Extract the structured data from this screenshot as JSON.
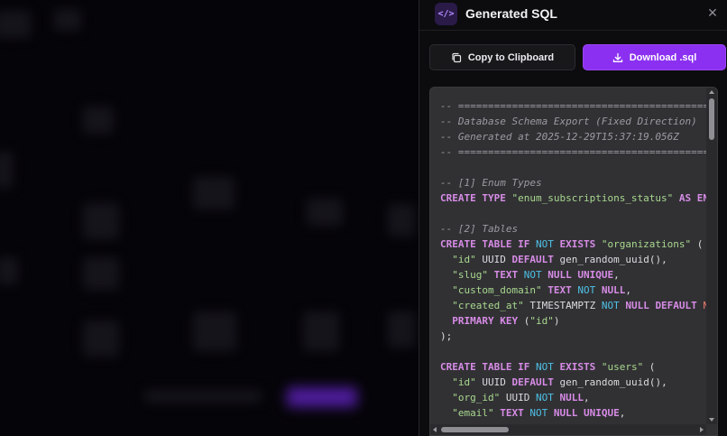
{
  "panel": {
    "title": "Generated SQL",
    "code_badge": "</>",
    "close_glyph": "✕"
  },
  "actions": {
    "copy_label": "Copy to Clipboard",
    "download_label": "Download .sql"
  },
  "colors": {
    "accent": "#8b30f0",
    "keyword": "#d78ce6",
    "string": "#a9d88e",
    "not_keyword": "#4fc1e6",
    "function": "#f07c70",
    "comment": "#9a9aa2"
  },
  "code_lines": [
    [
      {
        "t": "-- ===========================================",
        "c": "c"
      }
    ],
    [
      {
        "t": "-- Database Schema Export (Fixed Direction)",
        "c": "c"
      }
    ],
    [
      {
        "t": "-- Generated at 2025-12-29T15:37:19.056Z",
        "c": "c"
      }
    ],
    [
      {
        "t": "-- ===========================================",
        "c": "c"
      }
    ],
    [],
    [
      {
        "t": "-- [1] Enum Types",
        "c": "c"
      }
    ],
    [
      {
        "t": "CREATE TYPE ",
        "c": "k"
      },
      {
        "t": "\"enum_subscriptions_status\"",
        "c": "s"
      },
      {
        "t": " ",
        "c": ""
      },
      {
        "t": "AS ENUM",
        "c": "k"
      }
    ],
    [],
    [
      {
        "t": "-- [2] Tables",
        "c": "c"
      }
    ],
    [
      {
        "t": "CREATE TABLE IF ",
        "c": "k"
      },
      {
        "t": "NOT",
        "c": "n"
      },
      {
        "t": " EXISTS ",
        "c": "k"
      },
      {
        "t": "\"organizations\"",
        "c": "s"
      },
      {
        "t": " (",
        "c": ""
      }
    ],
    [
      {
        "t": "  ",
        "c": ""
      },
      {
        "t": "\"id\"",
        "c": "s"
      },
      {
        "t": " UUID ",
        "c": ""
      },
      {
        "t": "DEFAULT",
        "c": "k"
      },
      {
        "t": " gen_random_uuid(),",
        "c": ""
      }
    ],
    [
      {
        "t": "  ",
        "c": ""
      },
      {
        "t": "\"slug\"",
        "c": "s"
      },
      {
        "t": " TEXT ",
        "c": "k"
      },
      {
        "t": "NOT",
        "c": "n"
      },
      {
        "t": " NULL UNIQUE",
        "c": "k"
      },
      {
        "t": ",",
        "c": ""
      }
    ],
    [
      {
        "t": "  ",
        "c": ""
      },
      {
        "t": "\"custom_domain\"",
        "c": "s"
      },
      {
        "t": " TEXT ",
        "c": "k"
      },
      {
        "t": "NOT",
        "c": "n"
      },
      {
        "t": " NULL",
        "c": "k"
      },
      {
        "t": ",",
        "c": ""
      }
    ],
    [
      {
        "t": "  ",
        "c": ""
      },
      {
        "t": "\"created_at\"",
        "c": "s"
      },
      {
        "t": " TIMESTAMPTZ ",
        "c": ""
      },
      {
        "t": "NOT",
        "c": "n"
      },
      {
        "t": " NULL DEFAULT ",
        "c": "k"
      },
      {
        "t": "NOW",
        "c": "f"
      },
      {
        "t": "(",
        "c": ""
      }
    ],
    [
      {
        "t": "  ",
        "c": ""
      },
      {
        "t": "PRIMARY KEY",
        "c": "k"
      },
      {
        "t": " (",
        "c": ""
      },
      {
        "t": "\"id\"",
        "c": "s"
      },
      {
        "t": ")",
        "c": ""
      }
    ],
    [
      {
        "t": ");",
        "c": ""
      }
    ],
    [],
    [
      {
        "t": "CREATE TABLE IF ",
        "c": "k"
      },
      {
        "t": "NOT",
        "c": "n"
      },
      {
        "t": " EXISTS ",
        "c": "k"
      },
      {
        "t": "\"users\"",
        "c": "s"
      },
      {
        "t": " (",
        "c": ""
      }
    ],
    [
      {
        "t": "  ",
        "c": ""
      },
      {
        "t": "\"id\"",
        "c": "s"
      },
      {
        "t": " UUID ",
        "c": ""
      },
      {
        "t": "DEFAULT",
        "c": "k"
      },
      {
        "t": " gen_random_uuid(),",
        "c": ""
      }
    ],
    [
      {
        "t": "  ",
        "c": ""
      },
      {
        "t": "\"org_id\"",
        "c": "s"
      },
      {
        "t": " UUID ",
        "c": ""
      },
      {
        "t": "NOT",
        "c": "n"
      },
      {
        "t": " NULL",
        "c": "k"
      },
      {
        "t": ",",
        "c": ""
      }
    ],
    [
      {
        "t": "  ",
        "c": ""
      },
      {
        "t": "\"email\"",
        "c": "s"
      },
      {
        "t": " TEXT ",
        "c": "k"
      },
      {
        "t": "NOT",
        "c": "n"
      },
      {
        "t": " NULL UNIQUE",
        "c": "k"
      },
      {
        "t": ",",
        "c": ""
      }
    ]
  ]
}
